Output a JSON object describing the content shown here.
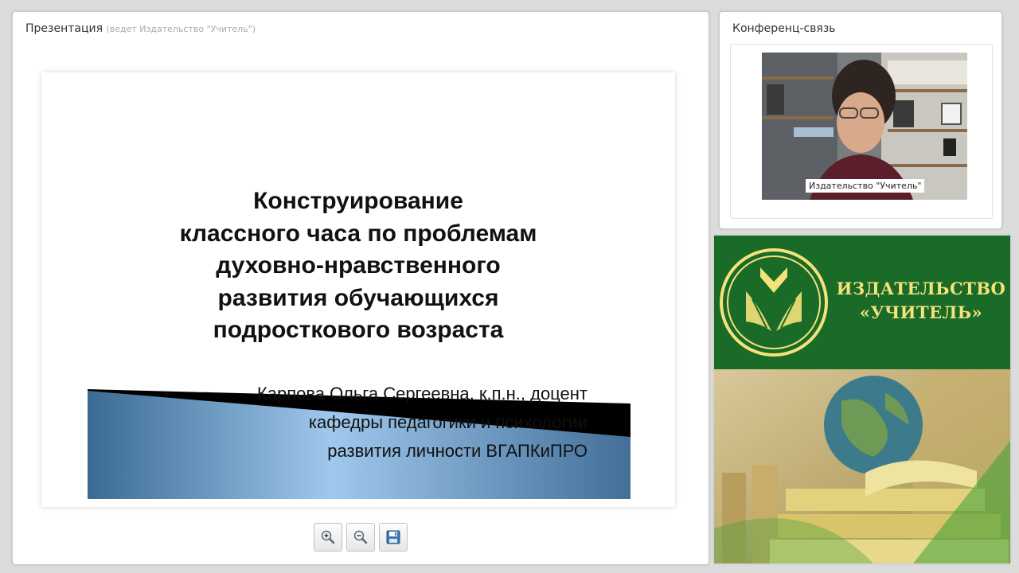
{
  "presentation": {
    "title": "Презентация",
    "subtitle": "(ведет Издательство \"Учитель\")",
    "slide": {
      "title": "Конструирование\nклассного часа по проблемам\nдуховно-нравственного\nразвития обучающихся\nподросткового возраста",
      "author": "Карпова Ольга Сергеевна, к.п.н., доцент\nкафедры педагогики и психологии\nразвития личности ВГАПКиПРО"
    },
    "toolbar": {
      "zoom_in_icon": "zoom-in-icon",
      "zoom_out_icon": "zoom-out-icon",
      "save_icon": "save-icon"
    }
  },
  "conference": {
    "title": "Конференц-связь",
    "video_label": "Издательство \"Учитель\""
  },
  "ad": {
    "publisher_name": "ИЗДАТЕЛЬСТВО\n«УЧИТЕЛЬ»",
    "colors": {
      "green": "#1a6a28",
      "gold": "#f4e27a"
    }
  }
}
